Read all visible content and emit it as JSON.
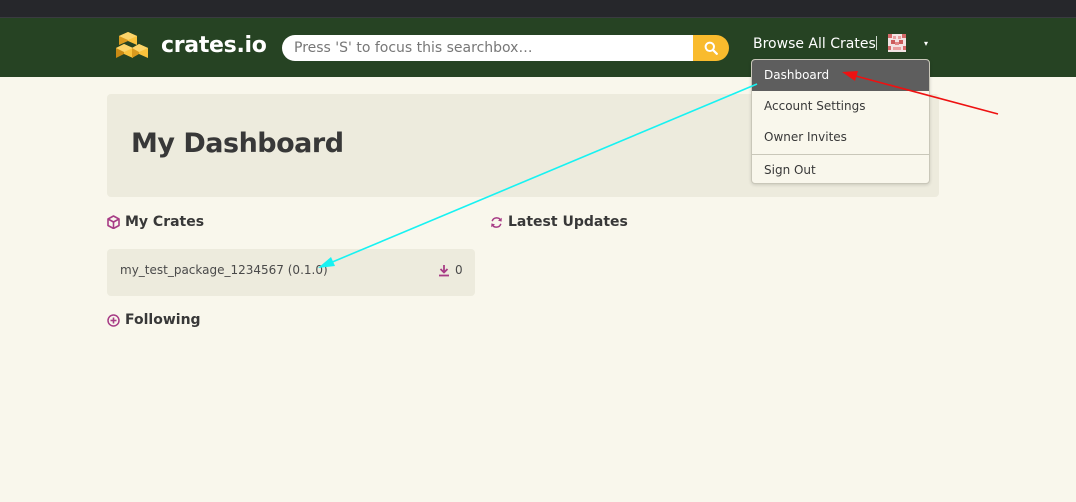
{
  "header": {
    "brand": "crates.io",
    "search_placeholder": "Press 'S' to focus this searchbox…",
    "browse_label": "Browse All Crates",
    "caret": "▾"
  },
  "user_menu": {
    "items": [
      {
        "label": "Dashboard",
        "active": true
      },
      {
        "label": "Account Settings"
      },
      {
        "label": "Owner Invites"
      },
      {
        "label": "Sign Out"
      }
    ]
  },
  "page": {
    "title": "My Dashboard"
  },
  "sections": {
    "my_crates": "My Crates",
    "latest_updates": "Latest Updates",
    "following": "Following"
  },
  "crates": [
    {
      "name": "my_test_package_1234567 (0.1.0)",
      "downloads": "0"
    }
  ],
  "colors": {
    "header_bg": "#264323",
    "page_bg": "#f9f7ec",
    "panel_bg": "#edebdd",
    "search_button": "#f9bb2d",
    "accent_icon": "#a73c86",
    "annotation_red": "#ee1111",
    "annotation_cyan": "#17f2f2"
  },
  "icons": {
    "logo": "crates-logo-icon",
    "search": "search-icon",
    "my_crates": "box-icon",
    "latest_updates": "refresh-icon",
    "following": "plus-circle-icon",
    "download": "download-icon"
  }
}
